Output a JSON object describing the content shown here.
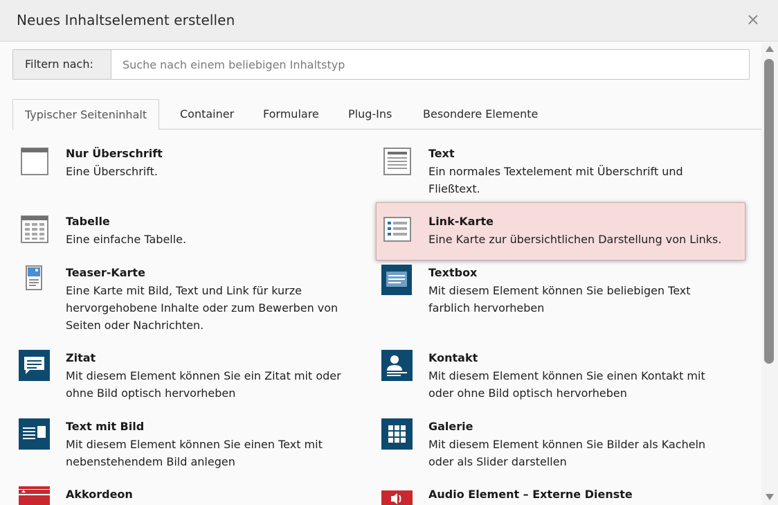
{
  "modal": {
    "title": "Neues Inhaltselement erstellen",
    "close_label": "×"
  },
  "filter": {
    "label": "Filtern nach:",
    "placeholder": "Suche nach einem beliebigen Inhaltstyp",
    "value": ""
  },
  "tabs": [
    {
      "label": "Typischer Seiteninhalt",
      "active": true
    },
    {
      "label": "Container",
      "active": false
    },
    {
      "label": "Formulare",
      "active": false
    },
    {
      "label": "Plug-Ins",
      "active": false
    },
    {
      "label": "Besondere Elemente",
      "active": false
    }
  ],
  "items": [
    {
      "title": "Nur Überschrift",
      "desc": "Eine Überschrift.",
      "icon": "header-icon"
    },
    {
      "title": "Text",
      "desc": "Ein normales Textelement mit Überschrift und Fließtext.",
      "icon": "text-icon"
    },
    {
      "title": "Tabelle",
      "desc": "Eine einfache Tabelle.",
      "icon": "table-icon"
    },
    {
      "title": "Link-Karte",
      "desc": "Eine Karte zur übersichtlichen Darstellung von Links.",
      "icon": "link-list-icon",
      "highlighted": true
    },
    {
      "title": "Teaser-Karte",
      "desc": "Eine Karte mit Bild, Text und Link für kurze hervorgehobene Inhalte oder zum Bewerben von Seiten oder Nachrichten.",
      "icon": "teaser-card-icon"
    },
    {
      "title": "Textbox",
      "desc": "Mit diesem Element können Sie beliebigen Text farblich hervorheben",
      "icon": "textbox-icon"
    },
    {
      "title": "Zitat",
      "desc": "Mit diesem Element können Sie ein Zitat mit oder ohne Bild optisch hervorheben",
      "icon": "quote-icon"
    },
    {
      "title": "Kontakt",
      "desc": "Mit diesem Element können Sie einen Kontakt mit oder ohne Bild optisch hervorheben",
      "icon": "contact-icon"
    },
    {
      "title": "Text mit Bild",
      "desc": "Mit diesem Element können Sie einen Text mit nebenstehendem Bild anlegen",
      "icon": "text-image-icon"
    },
    {
      "title": "Galerie",
      "desc": "Mit diesem Element können Sie Bilder als Kacheln oder als Slider darstellen",
      "icon": "gallery-icon"
    },
    {
      "title": "Akkordeon",
      "desc": "",
      "icon": "accordion-icon"
    },
    {
      "title": "Audio Element – Externe Dienste",
      "desc": "",
      "icon": "audio-icon"
    }
  ],
  "colors": {
    "dark_icon": "#0e4a6e",
    "red_icon": "#c8282e",
    "highlight_bg": "#f7dcdc"
  }
}
